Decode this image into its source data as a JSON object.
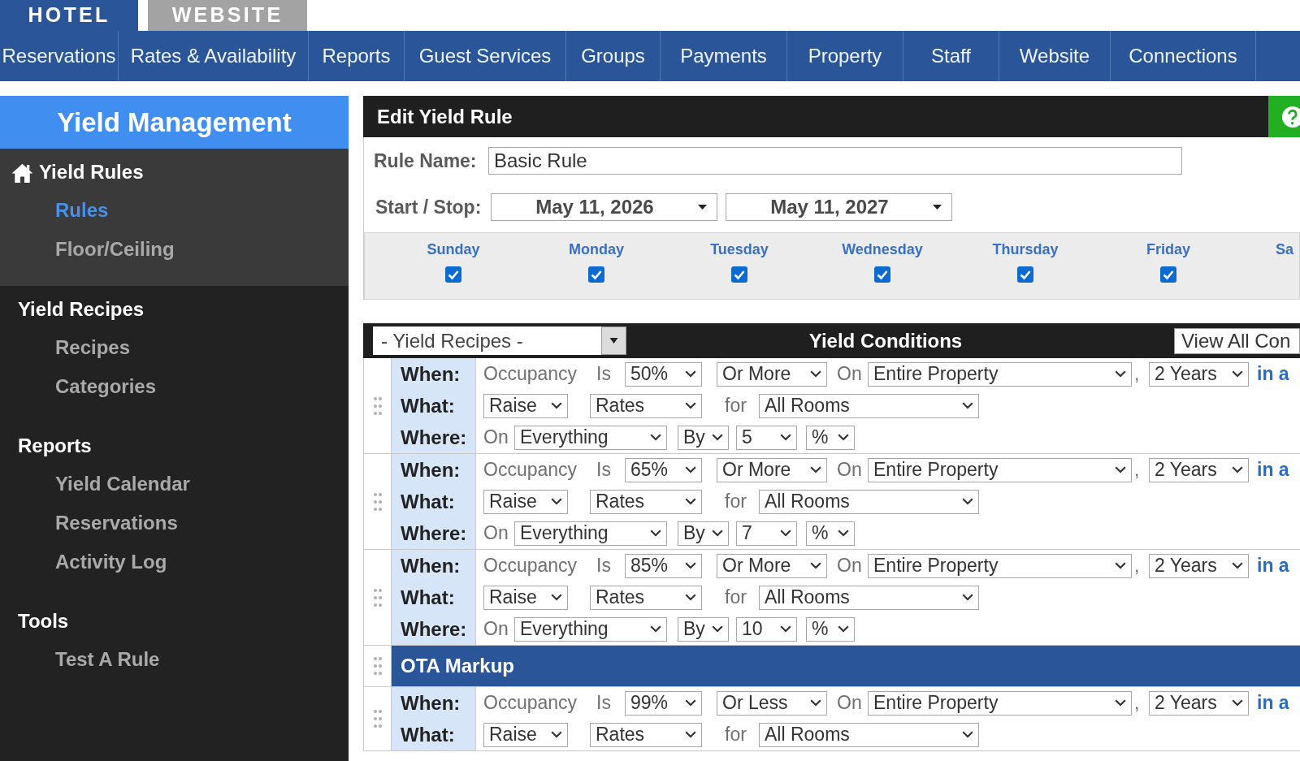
{
  "product_tabs": [
    {
      "label": "HOTEL",
      "selected": true
    },
    {
      "label": "WEBSITE",
      "selected": false
    }
  ],
  "nav": [
    "Reservations",
    "Rates & Availability",
    "Reports",
    "Guest Services",
    "Groups",
    "Payments",
    "Property",
    "Staff",
    "Website",
    "Connections"
  ],
  "sidebar": {
    "title": "Yield Management",
    "sections": [
      {
        "heading": "Yield Rules",
        "selected": true,
        "items": [
          {
            "label": "Rules",
            "selected": true
          },
          {
            "label": "Floor/Ceiling",
            "selected": false
          }
        ]
      },
      {
        "heading": "Yield Recipes",
        "selected": false,
        "items": [
          {
            "label": "Recipes",
            "selected": false
          },
          {
            "label": "Categories",
            "selected": false
          }
        ]
      },
      {
        "heading": "Reports",
        "selected": false,
        "items": [
          {
            "label": "Yield Calendar",
            "selected": false
          },
          {
            "label": "Reservations",
            "selected": false
          },
          {
            "label": "Activity Log",
            "selected": false
          }
        ]
      },
      {
        "heading": "Tools",
        "selected": false,
        "items": [
          {
            "label": "Test A Rule",
            "selected": false
          }
        ]
      }
    ]
  },
  "editor": {
    "title": "Edit Yield Rule",
    "rule_name": {
      "label": "Rule Name:",
      "value": "Basic Rule"
    },
    "start_stop": {
      "label": "Start / Stop:",
      "start": "May 11, 2026",
      "stop": "May 11, 2027"
    },
    "days": [
      {
        "label": "Sunday",
        "checked": true
      },
      {
        "label": "Monday",
        "checked": true
      },
      {
        "label": "Tuesday",
        "checked": true
      },
      {
        "label": "Wednesday",
        "checked": true
      },
      {
        "label": "Thursday",
        "checked": true
      },
      {
        "label": "Friday",
        "checked": true
      },
      {
        "label": "Sa"
      }
    ]
  },
  "conditions": {
    "recipes_select": "- Yield Recipes -",
    "title": "Yield Conditions",
    "view_all_button": "View All Con",
    "rows": [
      {
        "kind": "rule",
        "lines": [
          {
            "label": "When:",
            "parts": [
              {
                "kind": "text",
                "text": "Occupancy"
              },
              {
                "kind": "text",
                "text": "Is"
              },
              {
                "kind": "select",
                "value": "50%"
              },
              {
                "kind": "select",
                "value": "Or More"
              },
              {
                "kind": "text",
                "text": "On"
              },
              {
                "kind": "select",
                "value": "Entire Property"
              },
              {
                "kind": "text",
                "text": ","
              },
              {
                "kind": "select",
                "value": "2 Years"
              },
              {
                "kind": "link",
                "text": "in a"
              }
            ]
          },
          {
            "label": "What:",
            "parts": [
              {
                "kind": "select",
                "value": "Raise"
              },
              {
                "kind": "select",
                "value": "Rates"
              },
              {
                "kind": "text",
                "text": "for"
              },
              {
                "kind": "select",
                "value": "All Rooms"
              }
            ]
          },
          {
            "label": "Where:",
            "parts": [
              {
                "kind": "text",
                "text": "On"
              },
              {
                "kind": "select",
                "value": "Everything"
              },
              {
                "kind": "select",
                "value": "By"
              },
              {
                "kind": "select",
                "value": "5"
              },
              {
                "kind": "select",
                "value": "%"
              }
            ]
          }
        ]
      },
      {
        "kind": "rule",
        "lines": [
          {
            "label": "When:",
            "parts": [
              {
                "kind": "text",
                "text": "Occupancy"
              },
              {
                "kind": "text",
                "text": "Is"
              },
              {
                "kind": "select",
                "value": "65%"
              },
              {
                "kind": "select",
                "value": "Or More"
              },
              {
                "kind": "text",
                "text": "On"
              },
              {
                "kind": "select",
                "value": "Entire Property"
              },
              {
                "kind": "text",
                "text": ","
              },
              {
                "kind": "select",
                "value": "2 Years"
              },
              {
                "kind": "link",
                "text": "in a"
              }
            ]
          },
          {
            "label": "What:",
            "parts": [
              {
                "kind": "select",
                "value": "Raise"
              },
              {
                "kind": "select",
                "value": "Rates"
              },
              {
                "kind": "text",
                "text": "for"
              },
              {
                "kind": "select",
                "value": "All Rooms"
              }
            ]
          },
          {
            "label": "Where:",
            "parts": [
              {
                "kind": "text",
                "text": "On"
              },
              {
                "kind": "select",
                "value": "Everything"
              },
              {
                "kind": "select",
                "value": "By"
              },
              {
                "kind": "select",
                "value": "7"
              },
              {
                "kind": "select",
                "value": "%"
              }
            ]
          }
        ]
      },
      {
        "kind": "rule",
        "lines": [
          {
            "label": "When:",
            "parts": [
              {
                "kind": "text",
                "text": "Occupancy"
              },
              {
                "kind": "text",
                "text": "Is"
              },
              {
                "kind": "select",
                "value": "85%"
              },
              {
                "kind": "select",
                "value": "Or More"
              },
              {
                "kind": "text",
                "text": "On"
              },
              {
                "kind": "select",
                "value": "Entire Property"
              },
              {
                "kind": "text",
                "text": ","
              },
              {
                "kind": "select",
                "value": "2 Years"
              },
              {
                "kind": "link",
                "text": "in a"
              }
            ]
          },
          {
            "label": "What:",
            "parts": [
              {
                "kind": "select",
                "value": "Raise"
              },
              {
                "kind": "select",
                "value": "Rates"
              },
              {
                "kind": "text",
                "text": "for"
              },
              {
                "kind": "select",
                "value": "All Rooms"
              }
            ]
          },
          {
            "label": "Where:",
            "parts": [
              {
                "kind": "text",
                "text": "On"
              },
              {
                "kind": "select",
                "value": "Everything"
              },
              {
                "kind": "select",
                "value": "By"
              },
              {
                "kind": "select",
                "value": "10"
              },
              {
                "kind": "select",
                "value": "%"
              }
            ]
          }
        ]
      },
      {
        "kind": "header",
        "title": "OTA Markup"
      },
      {
        "kind": "rule",
        "lines": [
          {
            "label": "When:",
            "parts": [
              {
                "kind": "text",
                "text": "Occupancy"
              },
              {
                "kind": "text",
                "text": "Is"
              },
              {
                "kind": "select",
                "value": "99%"
              },
              {
                "kind": "select",
                "value": "Or Less"
              },
              {
                "kind": "text",
                "text": "On"
              },
              {
                "kind": "select",
                "value": "Entire Property"
              },
              {
                "kind": "text",
                "text": ","
              },
              {
                "kind": "select",
                "value": "2 Years"
              },
              {
                "kind": "link",
                "text": "in a"
              }
            ]
          },
          {
            "label": "What:",
            "parts": [
              {
                "kind": "select",
                "value": "Raise"
              },
              {
                "kind": "select",
                "value": "Rates"
              },
              {
                "kind": "text",
                "text": "for"
              },
              {
                "kind": "select",
                "value": "All Rooms"
              }
            ]
          }
        ]
      }
    ]
  }
}
